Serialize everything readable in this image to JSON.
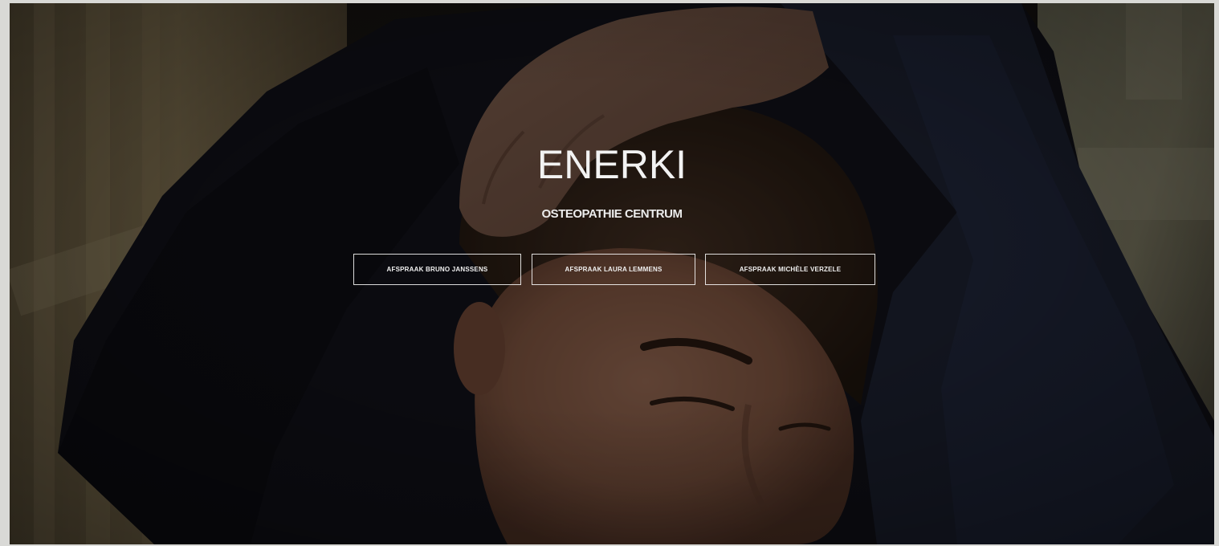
{
  "hero": {
    "title": "ENERKI",
    "subtitle": "OSTEOPATHIE CENTRUM",
    "buttons": [
      {
        "label": "AFSPRAAK BRUNO JANSSENS"
      },
      {
        "label": "AFSPRAAK LAURA LEMMENS"
      },
      {
        "label": "AFSPRAAK MICHÈLE VERZELE"
      }
    ],
    "background_image": "osteopath-treating-woman-head-photo",
    "colors": {
      "text": "#f2f2f2",
      "button_border": "#ffffff",
      "overlay": "#000000"
    }
  }
}
